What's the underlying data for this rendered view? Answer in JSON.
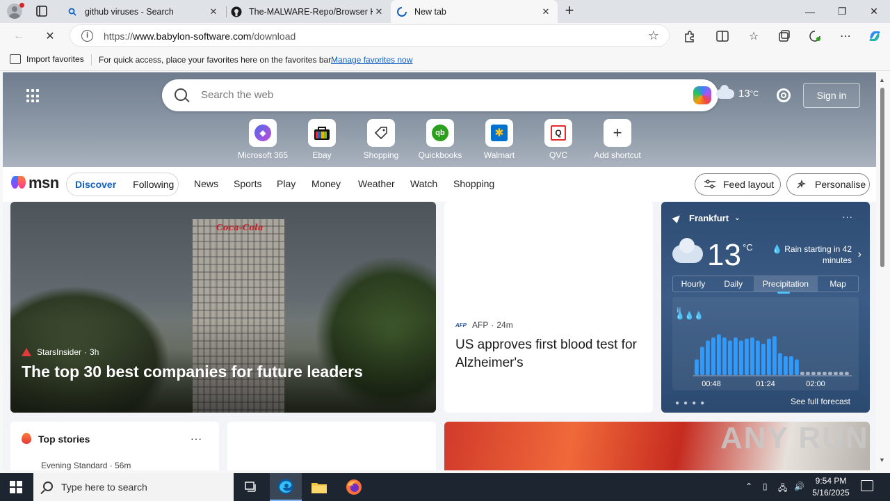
{
  "browser": {
    "tabs": [
      {
        "title": "github viruses - Search"
      },
      {
        "title": "The-MALWARE-Repo/Browser Hi"
      },
      {
        "title": "New tab"
      }
    ],
    "url_prefix": "https://",
    "url_host": "www.babylon-software.com",
    "url_path": "/download",
    "favorites_bar": {
      "import_label": "Import favorites",
      "hint": "For quick access, place your favorites here on the favorites bar.",
      "manage_link": "Manage favorites now"
    }
  },
  "newtab": {
    "search_placeholder": "Search the web",
    "temperature": "13",
    "temp_unit": "°C",
    "signin_label": "Sign in",
    "shortcuts": [
      {
        "label": "Microsoft 365",
        "color": "#6b4de6",
        "glyph": "◆"
      },
      {
        "label": "Ebay",
        "color": "#e53238",
        "glyph": "▦"
      },
      {
        "label": "Shopping",
        "color": "#ffffff",
        "glyph": "⌂"
      },
      {
        "label": "Quickbooks",
        "color": "#2ca01c",
        "glyph": "qb"
      },
      {
        "label": "Walmart",
        "color": "#0071ce",
        "glyph": "✱"
      },
      {
        "label": "QVC",
        "color": "#ffffff",
        "glyph": "Q"
      },
      {
        "label": "Add shortcut",
        "color": "#ffffff",
        "glyph": "+"
      }
    ]
  },
  "msn": {
    "logo": "msn",
    "pills": [
      "Discover",
      "Following"
    ],
    "nav": [
      "News",
      "Sports",
      "Play",
      "Money",
      "Weather",
      "Watch",
      "Shopping"
    ],
    "feed_layout_label": "Feed layout",
    "personalise_label": "Personalise"
  },
  "hero_story": {
    "source": "StarsInsider",
    "age": "3h",
    "title": "The top 30 best companies for future leaders",
    "sign": "Coca-Cola"
  },
  "news_story": {
    "source_logo": "AFP",
    "source": "AFP",
    "age": "24m",
    "title": "US approves first blood test for Alzheimer's"
  },
  "weather": {
    "location": "Frankfurt",
    "temp": "13",
    "unit": "°C",
    "rain_note": "Rain starting in 42 minutes",
    "tabs": [
      "Hourly",
      "Daily",
      "Precipitation",
      "Map"
    ],
    "chart_times": [
      "00:48",
      "01:24",
      "02:00"
    ],
    "precip_bars": [
      0.25,
      0.45,
      0.55,
      0.6,
      0.65,
      0.6,
      0.55,
      0.6,
      0.55,
      0.58,
      0.6,
      0.55,
      0.5,
      0.58,
      0.62,
      0.35,
      0.3,
      0.3,
      0.25,
      0.05,
      0.05,
      0.05,
      0.05,
      0.05,
      0.05,
      0.05,
      0.05,
      0.05
    ],
    "see_full": "See full forecast"
  },
  "top_stories": {
    "title": "Top stories",
    "first_source": "Evening Standard · 56m"
  },
  "watermark": "ANY RUN",
  "taskbar": {
    "search_placeholder": "Type here to search",
    "time": "9:54 PM",
    "date": "5/16/2025"
  }
}
